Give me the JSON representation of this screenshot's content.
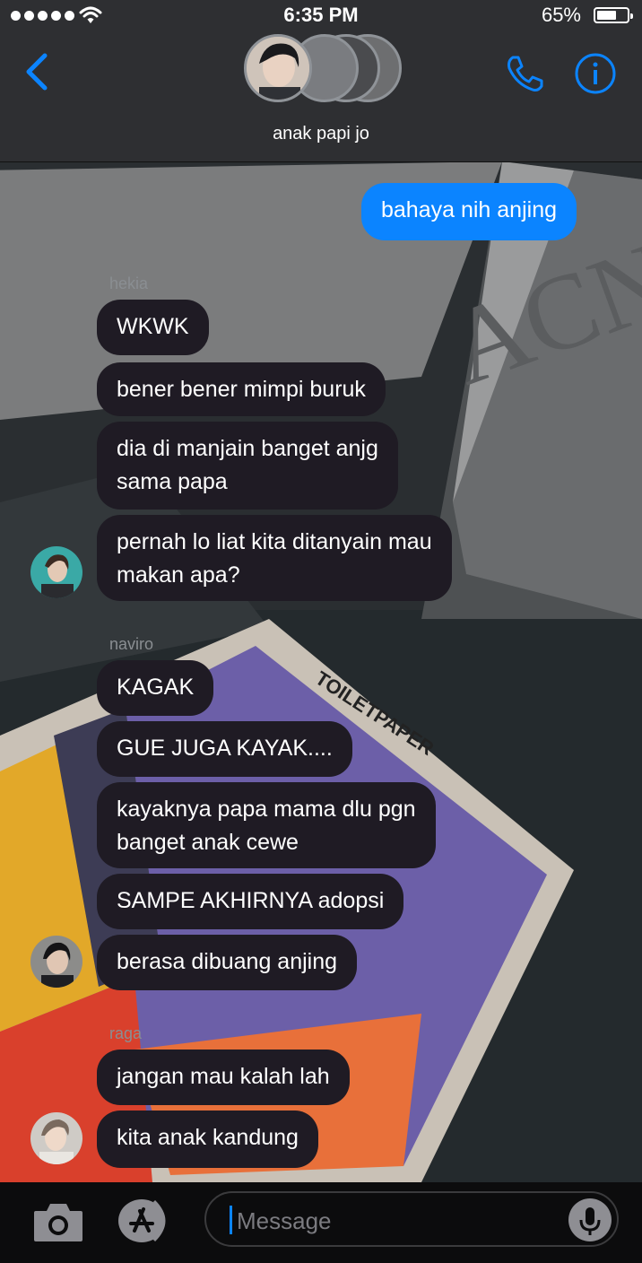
{
  "status_bar": {
    "time": "6:35 PM",
    "battery": "65%",
    "battery_level": 0.65
  },
  "header": {
    "group_name": "anak papi jo"
  },
  "messages": [
    {
      "type": "outgoing",
      "text": "bahaya nih anjing"
    },
    {
      "type": "sender",
      "text": "hekia"
    },
    {
      "type": "incoming",
      "text": "WKWK"
    },
    {
      "type": "incoming",
      "text": "bener bener mimpi buruk"
    },
    {
      "type": "incoming",
      "line1": "dia di manjain banget anjg",
      "line2": "sama papa"
    },
    {
      "type": "incoming",
      "line1": "pernah lo liat kita ditanyain mau",
      "line2": "makan apa?"
    },
    {
      "type": "sender",
      "text": "naviro"
    },
    {
      "type": "incoming",
      "text": "KAGAK"
    },
    {
      "type": "incoming",
      "text": "GUE JUGA KAYAK...."
    },
    {
      "type": "incoming",
      "line1": "kayaknya papa mama dlu pgn",
      "line2": "banget anak cewe"
    },
    {
      "type": "incoming",
      "text": "SAMPE AKHIRNYA adopsi"
    },
    {
      "type": "incoming",
      "text": "berasa dibuang anjing"
    },
    {
      "type": "sender",
      "text": "raga"
    },
    {
      "type": "incoming",
      "text": "jangan mau kalah lah"
    },
    {
      "type": "incoming",
      "text": "kita anak kandung"
    }
  ],
  "input": {
    "placeholder": "Message"
  },
  "icons": {
    "back": "chevron-left-icon",
    "call": "phone-icon",
    "info": "info-icon",
    "camera": "camera-icon",
    "apps": "app-store-icon",
    "mic": "microphone-icon"
  },
  "colors": {
    "accent": "#0b84ff",
    "incoming_bubble": "#1f1b24",
    "header": "#2e3033"
  }
}
